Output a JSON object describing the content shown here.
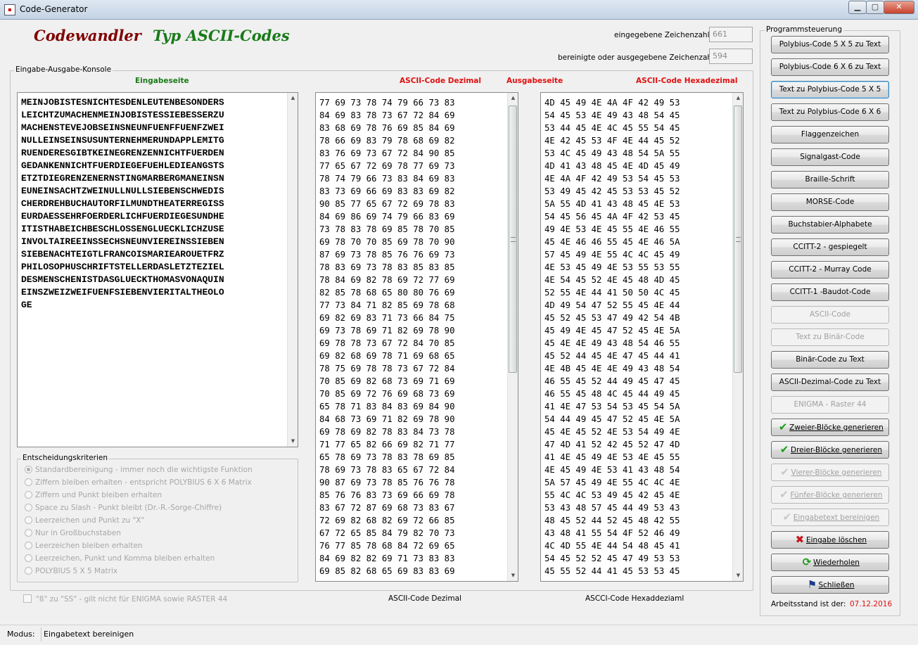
{
  "window": {
    "title": "Code-Generator"
  },
  "header": {
    "title1": "Codewandler",
    "title2": "Typ ASCII-Codes",
    "count_input_label": "eingegebene Zeichenzahl",
    "count_input_value": "661",
    "count_output_label": "bereinigte oder ausgegebene Zeichenzahl",
    "count_output_value": "594"
  },
  "console": {
    "group_label": "Eingabe-Ausgabe-Konsole",
    "input_label": "Eingabeseite",
    "dec_label": "ASCII-Code Dezimal",
    "output_label": "Ausgabeseite",
    "hex_label": "ASCII-Code Hexadezimal",
    "input_text": "MEINJOBISTESNICHTESDENLEUTENBESONDERS\nLEICHTZUMACHENMEINJOBISTESSIEBESSERZU\nMACHENSTEVEJOBSEINSNEUNFUENFFUENFZWEI\nNULLEINSEINSUSUNTERNEHMERUNDAPPLEMITG\nRUENDERESGIBTKEINEGRENZENNICHTFUERDEN\nGEDANKENNICHTFUERDIEGEFUEHLEDIEANGSTS\nETZTDIEGRENZENERNSTINGMARBERGMANEINSN\nEUNEINSACHTZWEINULLNULLSIEBENSCHWEDIS\nCHERDREHBUCHAUTORFILMUNDTHEATERREGISS\nEURDAESSEHRFOERDERLICHFUERDIEGESUNDHE\nITISTHABEICHBESCHLOSSENGLUECKLICHZUSE\nINVOLTAIREEINSSECHSNEUNVIEREINSSIEBEN\nSIEBENACHTEIGTLFRANCOISMARIEAROUETFRZ\nPHILOSOPHUSCHRIFTSTELLERDASLETZTEZIEL\nDESMENSCHENISTDASGLUECKTHOMASVONAQUIN\nEINSZWEIZWEIFUENFSIEBENVIERITALTHEOLO\nGE",
    "dec_text": "77 69 73 78 74 79 66 73 83\n84 69 83 78 73 67 72 84 69\n83 68 69 78 76 69 85 84 69\n78 66 69 83 79 78 68 69 82\n83 76 69 73 67 72 84 90 85\n77 65 67 72 69 78 77 69 73\n78 74 79 66 73 83 84 69 83\n83 73 69 66 69 83 83 69 82\n90 85 77 65 67 72 69 78 83\n84 69 86 69 74 79 66 83 69\n73 78 83 78 69 85 78 70 85\n69 78 70 70 85 69 78 70 90\n87 69 73 78 85 76 76 69 73\n78 83 69 73 78 83 85 83 85\n78 84 69 82 78 69 72 77 69\n82 85 78 68 65 80 80 76 69\n77 73 84 71 82 85 69 78 68\n69 82 69 83 71 73 66 84 75\n69 73 78 69 71 82 69 78 90\n69 78 78 73 67 72 84 70 85\n69 82 68 69 78 71 69 68 65\n78 75 69 78 78 73 67 72 84\n70 85 69 82 68 73 69 71 69\n70 85 69 72 76 69 68 73 69\n65 78 71 83 84 83 69 84 90\n84 68 73 69 71 82 69 78 90\n69 78 69 82 78 83 84 73 78\n71 77 65 82 66 69 82 71 77\n65 78 69 73 78 83 78 69 85\n78 69 73 78 83 65 67 72 84\n90 87 69 73 78 85 76 76 78\n85 76 76 83 73 69 66 69 78\n83 67 72 87 69 68 73 83 67\n72 69 82 68 82 69 72 66 85\n67 72 65 85 84 79 82 70 73\n76 77 85 78 68 84 72 69 65\n84 69 82 82 69 71 73 83 83\n69 85 82 68 65 69 83 83 69",
    "hex_text": "4D 45 49 4E 4A 4F 42 49 53\n54 45 53 4E 49 43 48 54 45\n53 44 45 4E 4C 45 55 54 45\n4E 42 45 53 4F 4E 44 45 52\n53 4C 45 49 43 48 54 5A 55\n4D 41 43 48 45 4E 4D 45 49\n4E 4A 4F 42 49 53 54 45 53\n53 49 45 42 45 53 53 45 52\n5A 55 4D 41 43 48 45 4E 53\n54 45 56 45 4A 4F 42 53 45\n49 4E 53 4E 45 55 4E 46 55\n45 4E 46 46 55 45 4E 46 5A\n57 45 49 4E 55 4C 4C 45 49\n4E 53 45 49 4E 53 55 53 55\n4E 54 45 52 4E 45 48 4D 45\n52 55 4E 44 41 50 50 4C 45\n4D 49 54 47 52 55 45 4E 44\n45 52 45 53 47 49 42 54 4B\n45 49 4E 45 47 52 45 4E 5A\n45 4E 4E 49 43 48 54 46 55\n45 52 44 45 4E 47 45 44 41\n4E 4B 45 4E 4E 49 43 48 54\n46 55 45 52 44 49 45 47 45\n46 55 45 48 4C 45 44 49 45\n41 4E 47 53 54 53 45 54 5A\n54 44 49 45 47 52 45 4E 5A\n45 4E 45 52 4E 53 54 49 4E\n47 4D 41 52 42 45 52 47 4D\n41 4E 45 49 4E 53 4E 45 55\n4E 45 49 4E 53 41 43 48 54\n5A 57 45 49 4E 55 4C 4C 4E\n55 4C 4C 53 49 45 42 45 4E\n53 43 48 57 45 44 49 53 43\n48 45 52 44 52 45 48 42 55\n43 48 41 55 54 4F 52 46 49\n4C 4D 55 4E 44 54 48 45 41\n54 45 52 52 45 47 49 53 53\n45 55 52 44 41 45 53 53 45"
  },
  "criteria": {
    "group_label": "Entscheidungskriterien",
    "options": [
      {
        "label": "Standardbereinigung - immer noch die wichtigste Funktion",
        "selected": true
      },
      {
        "label": "Ziffern bleiben erhalten - entspricht POLYBIUS 6 X 6 Matrix",
        "selected": false
      },
      {
        "label": "Ziffern und Punkt bleiben erhalten",
        "selected": false
      },
      {
        "label": "Space zu Slash - Punkt bleibt  (Dr.-R.-Sorge-Chiffre)",
        "selected": false
      },
      {
        "label": "Leerzeichen und Punkt zu \"X\"",
        "selected": false
      },
      {
        "label": "Nur in Großbuchstaben",
        "selected": false
      },
      {
        "label": "Leerzeichen bleiben erhalten",
        "selected": false
      },
      {
        "label": "Leerzeichen, Punkt und Komma bleiben erhalten",
        "selected": false
      },
      {
        "label": "POLYBIUS 5 X 5 Matrix",
        "selected": false
      }
    ],
    "checkbox_label": "\"ß\" zu \"SS\" - gilt nicht für ENIGMA sowie RASTER 44"
  },
  "bottom_labels": {
    "dec": "ASCII-Code Dezimal",
    "hex": "ASCCI-Code Hexaddeziaml"
  },
  "controls": {
    "group_label": "Programmsteuerung",
    "buttons": [
      {
        "label": "Polybius-Code 5 X 5  zu Text"
      },
      {
        "label": "Polybius-Code 6 X 6  zu Text"
      },
      {
        "label": "Text zu Polybius-Code 5 X 5"
      },
      {
        "label": "Text zu Polybius-Code 6  X 6"
      },
      {
        "label": "Flaggenzeichen"
      },
      {
        "label": "Signalgast-Code"
      },
      {
        "label": "Braille-Schrift"
      },
      {
        "label": "MORSE-Code"
      },
      {
        "label": "Buchstabier-Alphabete"
      },
      {
        "label": "CCITT-2 - gespiegelt"
      },
      {
        "label": "CCITT-2 - Murray Code"
      },
      {
        "label": "CCITT-1  -Baudot-Code"
      },
      {
        "label": "ASCII-Code"
      },
      {
        "label": "Text zu Binär-Code"
      },
      {
        "label": "Binär-Code zu Text"
      },
      {
        "label": "ASCII-Dezimal-Code zu Text"
      },
      {
        "label": "ENIGMA - Raster 44"
      },
      {
        "label": "Zweier-Blöcke generieren"
      },
      {
        "label": "Dreier-Blöcke generieren"
      },
      {
        "label": "Vierer-Blöcke generieren"
      },
      {
        "label": "Fünfer-Blöcke generieren"
      },
      {
        "label": "Eingabetext bereinigen"
      },
      {
        "label": "Eingabe löschen"
      },
      {
        "label": "Wiederholen"
      },
      {
        "label": "Schließen"
      }
    ],
    "date_label": "Arbeitsstand ist der:",
    "date_value": "07.12.2016"
  },
  "status": {
    "label": "Modus:",
    "value": "Eingabetext bereinigen"
  },
  "colors": {
    "title1": "#800000",
    "title2": "#1a7a1a",
    "accent_red": "#e01010",
    "accent_green": "#1a7a1a"
  }
}
